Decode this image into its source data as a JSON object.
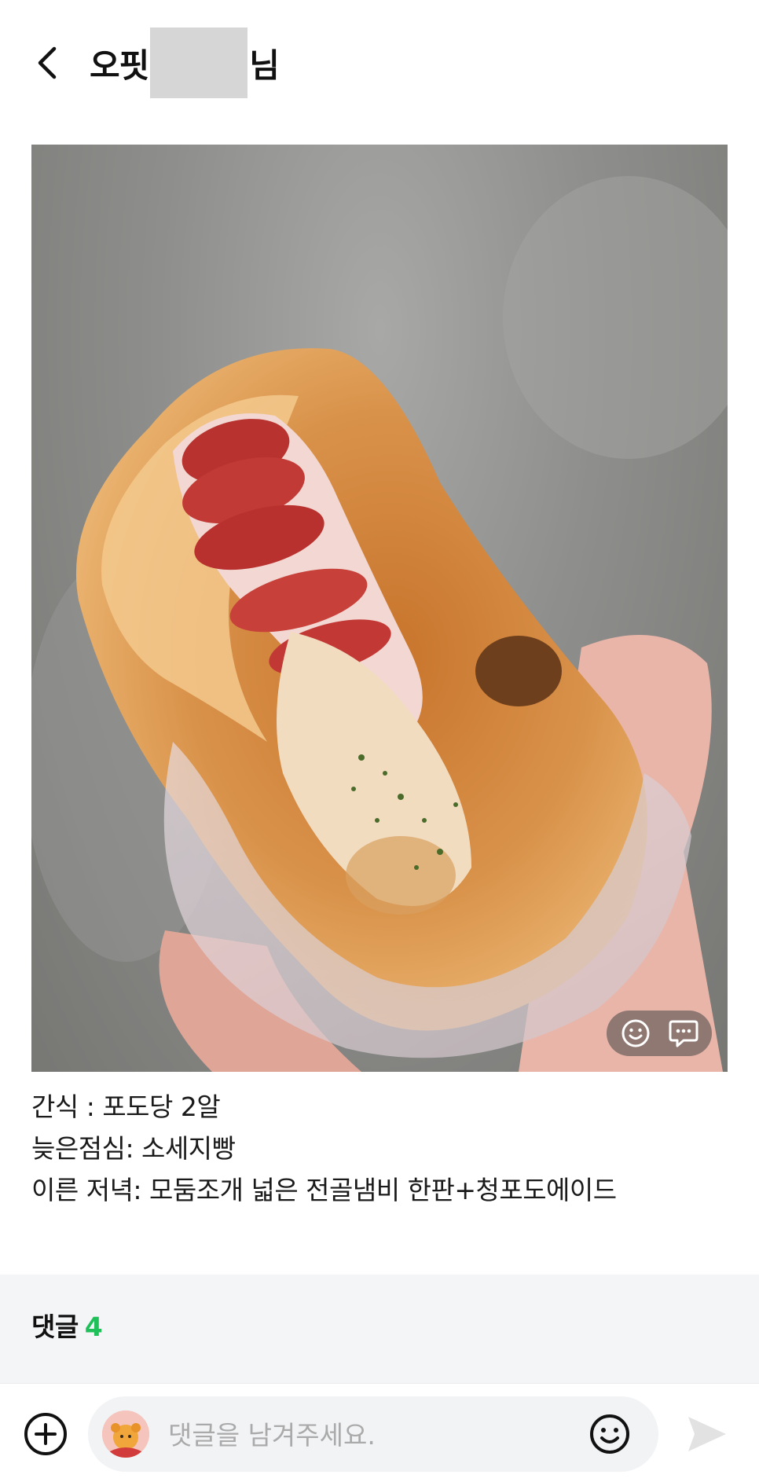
{
  "header": {
    "title_prefix": "오핏",
    "title_suffix": "님",
    "back_icon": "chevron-left-icon"
  },
  "photo": {
    "description_alt": "소세지빵",
    "actions": {
      "emoji_icon": "smiley-icon",
      "comment_icon": "speech-bubble-icon"
    }
  },
  "post": {
    "lines": [
      "간식 : 포도당 2알",
      "늦은점심: 소세지빵",
      "이른 저녁: 모둠조개 넓은 전골냄비 한판+청포도에이드"
    ]
  },
  "comments": {
    "label": "댓글",
    "count": "4",
    "count_color": "#1fbf5a"
  },
  "input_bar": {
    "placeholder": "댓글을 남겨주세요.",
    "add_icon": "plus-circle-icon",
    "emoji_icon": "smiley-icon",
    "send_icon": "send-arrow-icon"
  }
}
